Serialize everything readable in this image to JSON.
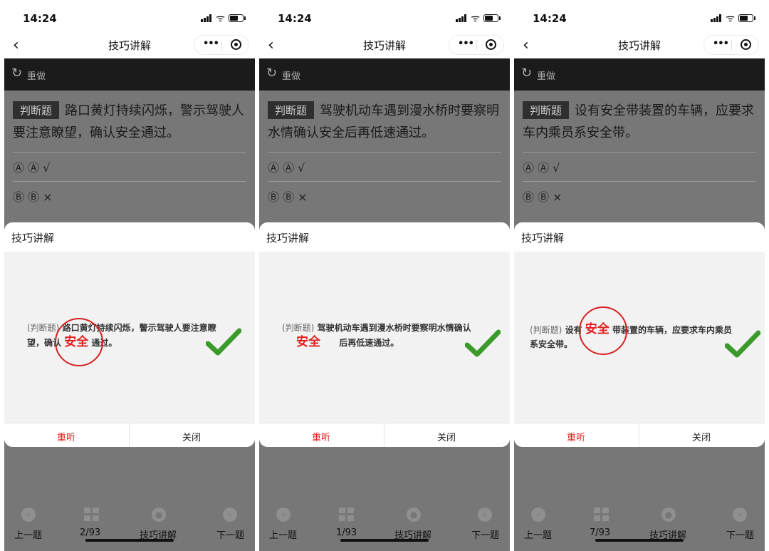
{
  "screens": [
    {
      "status": {
        "time": "14:24"
      },
      "nav": {
        "title": "技巧讲解"
      },
      "toolbar": {
        "redo": "重做"
      },
      "question": {
        "tag": "判断题",
        "text": "路口黄灯持续闪烁，警示驾驶人要注意瞭望，确认安全通过。"
      },
      "options": [
        {
          "marks": "Ⓐ  Ⓐ √"
        },
        {
          "marks": "Ⓑ  Ⓑ ×"
        }
      ],
      "sheet": {
        "title": "技巧讲解",
        "prefix": "(判断题)",
        "line1": "路口黄灯持续闪烁，警示驾驶人要注意瞭",
        "line2_a": "望，确认",
        "keyword": "安全",
        "line2_b": "通过。",
        "replay": "重听",
        "close": "关闭"
      },
      "bottom": {
        "prev": "上一题",
        "progress": "2/93",
        "tips": "技巧讲解",
        "next": "下一题"
      }
    },
    {
      "status": {
        "time": "14:24"
      },
      "nav": {
        "title": "技巧讲解"
      },
      "toolbar": {
        "redo": "重做"
      },
      "question": {
        "tag": "判断题",
        "text": "驾驶机动车遇到漫水桥时要察明水情确认安全后再低速通过。"
      },
      "options": [
        {
          "marks": "Ⓐ  Ⓐ √"
        },
        {
          "marks": "Ⓑ  Ⓑ ×"
        }
      ],
      "sheet": {
        "title": "技巧讲解",
        "prefix": "(判断题)",
        "line1": "驾驶机动车遇到漫水桥时要察明水情确认",
        "keyword": "安全",
        "line2_b": "后再低速通过。",
        "replay": "重听",
        "close": "关闭"
      },
      "bottom": {
        "prev": "上一题",
        "progress": "1/93",
        "tips": "技巧讲解",
        "next": "下一题"
      }
    },
    {
      "status": {
        "time": "14:24"
      },
      "nav": {
        "title": "技巧讲解"
      },
      "toolbar": {
        "redo": "重做"
      },
      "question": {
        "tag": "判断题",
        "text": "设有安全带装置的车辆，应要求车内乘员系安全带。"
      },
      "options": [
        {
          "marks": "Ⓐ  Ⓐ √"
        },
        {
          "marks": "Ⓑ  Ⓑ ×"
        }
      ],
      "sheet": {
        "title": "技巧讲解",
        "prefix": "(判断题)",
        "line1_a": "设有",
        "keyword": "安全",
        "line1_b": "带装置的车辆，应要求车内乘员",
        "line2": "系安全带。",
        "replay": "重听",
        "close": "关闭"
      },
      "bottom": {
        "prev": "上一题",
        "progress": "7/93",
        "tips": "技巧讲解",
        "next": "下一题"
      }
    }
  ],
  "colors": {
    "accent_red": "#e02020",
    "check_green": "#3a9a2a",
    "toolbar_bg": "#1b1b1b",
    "overlay_gray": "#777777"
  }
}
